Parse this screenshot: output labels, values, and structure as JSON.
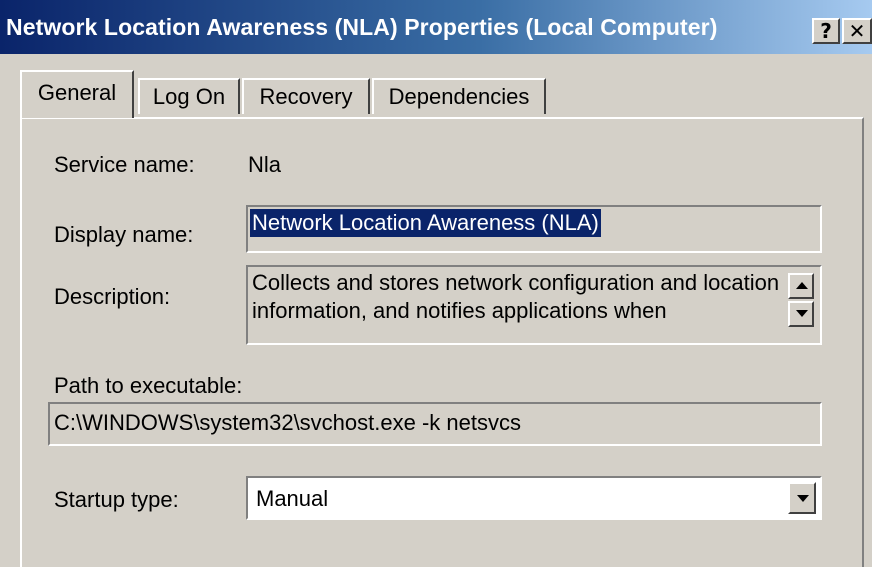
{
  "window": {
    "title": "Network Location Awareness (NLA) Properties (Local Computer)",
    "help_glyph": "?",
    "close_glyph": "✕"
  },
  "tabs": [
    {
      "label": "General",
      "active": true
    },
    {
      "label": "Log On",
      "active": false
    },
    {
      "label": "Recovery",
      "active": false
    },
    {
      "label": "Dependencies",
      "active": false
    }
  ],
  "general": {
    "service_name_label": "Service name:",
    "service_name_value": "Nla",
    "display_name_label": "Display name:",
    "display_name_value": "Network Location Awareness (NLA)",
    "description_label": "Description:",
    "description_value": "Collects and stores network configuration and location information, and notifies applications when",
    "path_label": "Path to executable:",
    "path_value": "C:\\WINDOWS\\system32\\svchost.exe -k netsvcs",
    "startup_type_label": "Startup type:",
    "startup_type_value": "Manual"
  },
  "colors": {
    "titlebar_start": "#0a246a",
    "titlebar_end": "#a6caf0",
    "dialog_face": "#d4d0c8",
    "selection": "#0a246a"
  },
  "icons": {
    "scroll_up": "arrow-up-icon",
    "scroll_down": "arrow-down-icon",
    "dropdown": "chevron-down-icon"
  }
}
